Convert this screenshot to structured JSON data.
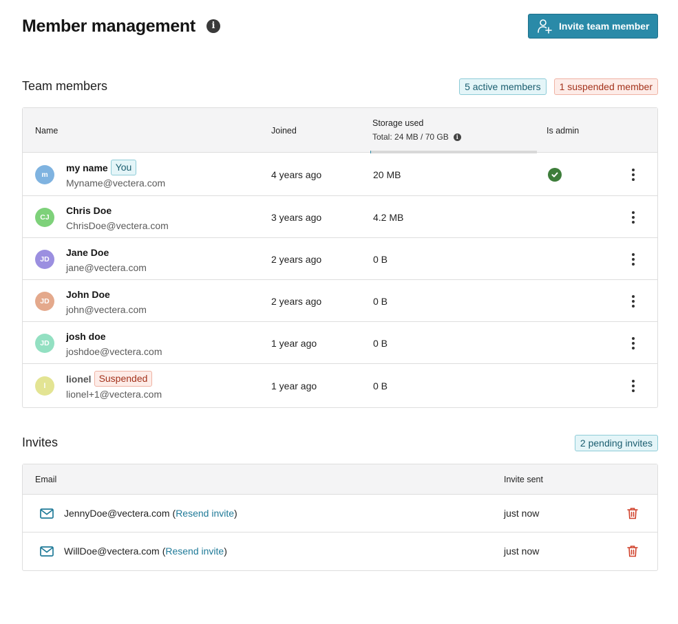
{
  "header": {
    "title": "Member management",
    "invite_button_label": "Invite team member"
  },
  "members_section": {
    "title": "Team members",
    "active_badge": "5 active members",
    "suspended_badge": "1 suspended member",
    "columns": {
      "name": "Name",
      "joined": "Joined",
      "storage": "Storage used",
      "storage_total": "Total: 24 MB / 70 GB",
      "admin": "Is admin"
    },
    "storage_fraction": 0.0003,
    "rows": [
      {
        "initials": "m",
        "name": "my name",
        "tag": "You",
        "email": "Myname@vectera.com",
        "joined": "4 years ago",
        "storage": "20 MB",
        "admin": true,
        "avatar_color": "#7fb3e0"
      },
      {
        "initials": "CJ",
        "name": "Chris Doe",
        "tag": "",
        "email": "ChrisDoe@vectera.com",
        "joined": "3 years ago",
        "storage": "4.2 MB",
        "admin": false,
        "avatar_color": "#7ed17a"
      },
      {
        "initials": "JD",
        "name": "Jane Doe",
        "tag": "",
        "email": "jane@vectera.com",
        "joined": "2 years ago",
        "storage": "0 B",
        "admin": false,
        "avatar_color": "#9b8fe0"
      },
      {
        "initials": "JD",
        "name": "John Doe",
        "tag": "",
        "email": "john@vectera.com",
        "joined": "2 years ago",
        "storage": "0 B",
        "admin": false,
        "avatar_color": "#e4a98c"
      },
      {
        "initials": "JD",
        "name": "josh doe",
        "tag": "",
        "email": "joshdoe@vectera.com",
        "joined": "1 year ago",
        "storage": "0 B",
        "admin": false,
        "avatar_color": "#93e0c2"
      },
      {
        "initials": "l",
        "name": "lionel",
        "tag": "Suspended",
        "email": "lionel+1@vectera.com",
        "joined": "1 year ago",
        "storage": "0 B",
        "admin": false,
        "avatar_color": "#e3e493"
      }
    ]
  },
  "invites_section": {
    "title": "Invites",
    "pending_badge": "2 pending invites",
    "columns": {
      "email": "Email",
      "sent": "Invite sent"
    },
    "resend_label": "Resend invite",
    "rows": [
      {
        "email": "JennyDoe@vectera.com",
        "sent": "just now"
      },
      {
        "email": "WillDoe@vectera.com",
        "sent": "just now"
      }
    ]
  },
  "colors": {
    "accent": "#2a8aa8",
    "link": "#1f7a98",
    "admin_check": "#3d7d3a",
    "danger": "#d0402a"
  }
}
